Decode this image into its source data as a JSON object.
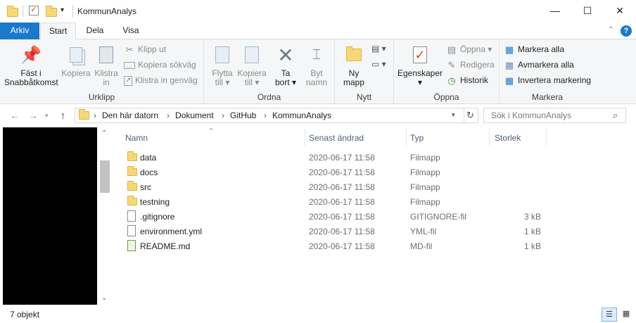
{
  "window": {
    "title": "KommunAnalys",
    "controls": {
      "minimize": "—",
      "maximize": "☐",
      "close": "✕"
    }
  },
  "ribbon_tabs": [
    "Arkiv",
    "Start",
    "Dela",
    "Visa"
  ],
  "ribbon": {
    "urklipp": {
      "label": "Urklipp",
      "pin": "Fäst i Snabbåtkomst",
      "pin_l1": "Fäst i",
      "pin_l2": "Snabbåtkomst",
      "copy": "Kopiera",
      "paste_l1": "Klistra",
      "paste_l2": "in",
      "cut": "Klipp ut",
      "copy_path": "Kopiera sökväg",
      "paste_shortcut": "Klistra in genväg"
    },
    "ordna": {
      "label": "Ordna",
      "move_l1": "Flytta",
      "move_l2": "till",
      "copy_l1": "Kopiera",
      "copy_l2": "till",
      "delete_l1": "Ta",
      "delete_l2": "bort",
      "rename_l1": "Byt",
      "rename_l2": "namn"
    },
    "nytt": {
      "label": "Nytt",
      "new_folder_l1": "Ny",
      "new_folder_l2": "mapp"
    },
    "oppna": {
      "label": "Öppna",
      "properties": "Egenskaper",
      "open": "Öppna",
      "edit": "Redigera",
      "history": "Historik"
    },
    "markera": {
      "label": "Markera",
      "select_all": "Markera alla",
      "select_none": "Avmarkera alla",
      "invert": "Invertera markering"
    }
  },
  "address": {
    "breadcrumb": [
      "Den här datorn",
      "Dokument",
      "GitHub",
      "KommunAnalys"
    ],
    "search_placeholder": "Sök i KommunAnalys"
  },
  "columns": [
    "Namn",
    "Senast ändrad",
    "Typ",
    "Storlek"
  ],
  "files": [
    {
      "name": "data",
      "date": "2020-06-17 11:58",
      "type": "Filmapp",
      "size": "",
      "icon": "folder-icon"
    },
    {
      "name": "docs",
      "date": "2020-06-17 11:58",
      "type": "Filmapp",
      "size": "",
      "icon": "folder-icon"
    },
    {
      "name": "src",
      "date": "2020-06-17 11:58",
      "type": "Filmapp",
      "size": "",
      "icon": "folder-icon"
    },
    {
      "name": "testning",
      "date": "2020-06-17 11:58",
      "type": "Filmapp",
      "size": "",
      "icon": "folder-icon"
    },
    {
      "name": ".gitignore",
      "date": "2020-06-17 11:58",
      "type": "GITIGNORE-fil",
      "size": "3 kB",
      "icon": "file-icon"
    },
    {
      "name": "environment.yml",
      "date": "2020-06-17 11:58",
      "type": "YML-fil",
      "size": "1 kB",
      "icon": "file-icon"
    },
    {
      "name": "README.md",
      "date": "2020-06-17 11:58",
      "type": "MD-fil",
      "size": "1 kB",
      "icon": "markdown-file-icon"
    }
  ],
  "status": {
    "count": "7 objekt"
  }
}
